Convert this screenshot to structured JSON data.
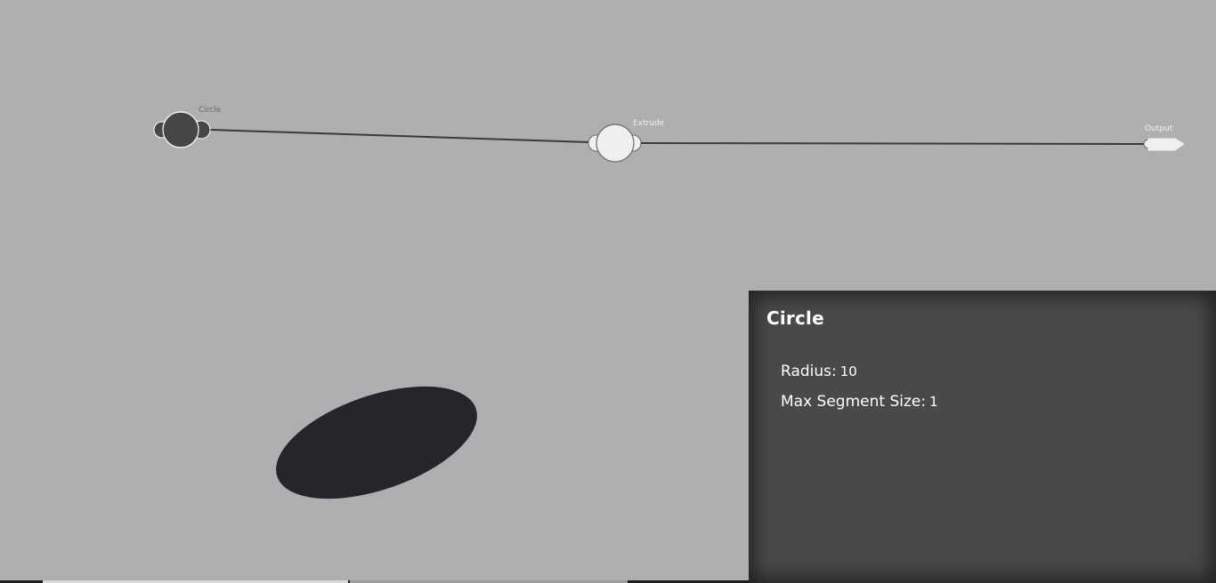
{
  "graph": {
    "nodes": [
      {
        "id": "circle",
        "label": "Circle",
        "state": "selected"
      },
      {
        "id": "extrude",
        "label": "Extrude",
        "state": "normal"
      },
      {
        "id": "output",
        "label": "Output",
        "state": "output"
      }
    ],
    "edges": [
      {
        "from": "circle",
        "to": "extrude"
      },
      {
        "from": "extrude",
        "to": "output"
      }
    ],
    "colors": {
      "background": "#b0aeb0",
      "selected_node": "#474747",
      "normal_node": "#f0eeee",
      "edge": "#3a3a3a",
      "label_dark": "#6a6a6a",
      "label_light": "#f2f2f2"
    }
  },
  "preview": {
    "shape": "ellipse",
    "fill": "#24262a"
  },
  "panel": {
    "title": "Circle",
    "params": [
      {
        "label": "Radius:",
        "value": "10"
      },
      {
        "label": "Max Segment Size:",
        "value": "1"
      }
    ],
    "background": "#494949"
  }
}
